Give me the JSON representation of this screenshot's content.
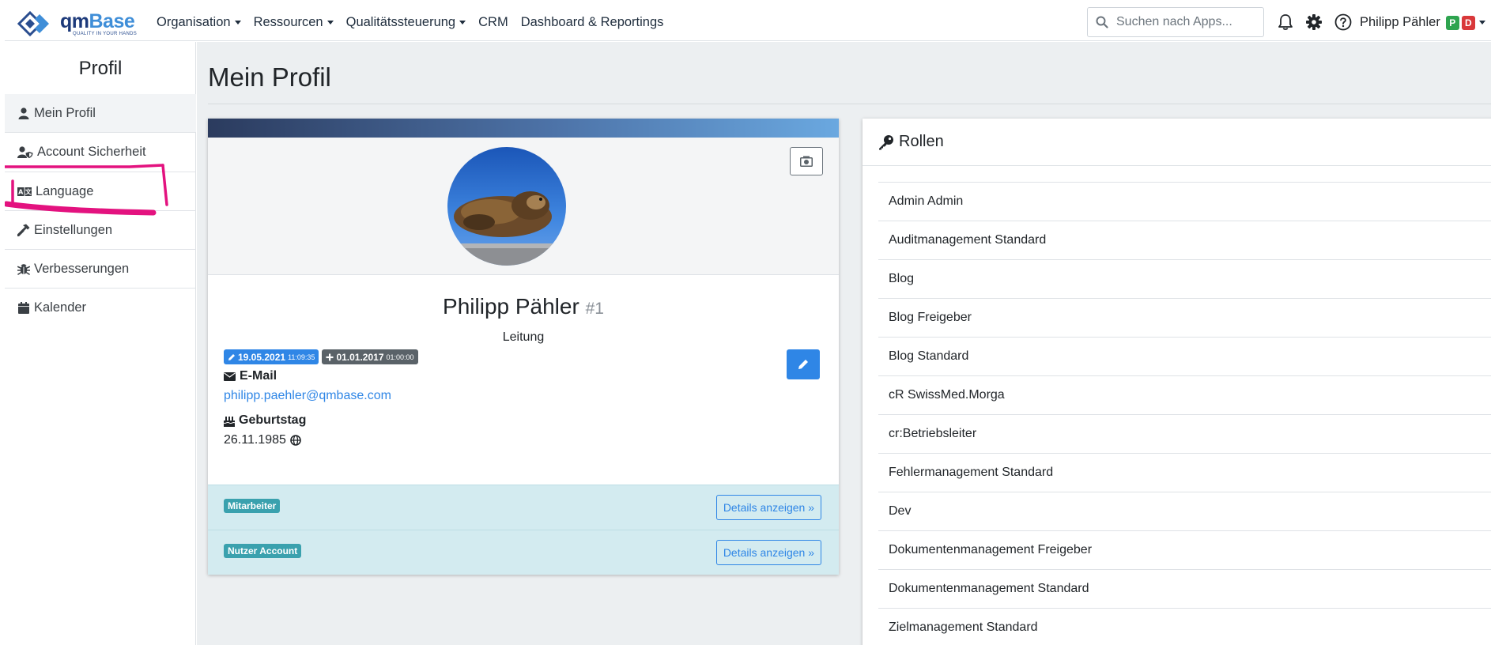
{
  "brand": {
    "name_part1": "qm",
    "name_part2": "Base",
    "tagline": "QUALITY IN YOUR HANDS"
  },
  "nav": {
    "menu": [
      {
        "label": "Organisation",
        "dropdown": true
      },
      {
        "label": "Ressourcen",
        "dropdown": true
      },
      {
        "label": "Qualitätssteuerung",
        "dropdown": true
      },
      {
        "label": "CRM",
        "dropdown": false
      },
      {
        "label": "Dashboard & Reportings",
        "dropdown": false
      }
    ],
    "search_placeholder": "Suchen nach Apps...",
    "icons": [
      "bell-icon",
      "gear-icon",
      "help-icon",
      "search-icon"
    ],
    "user": {
      "name": "Philipp Pähler",
      "badge1": "P",
      "badge2": "D",
      "badge1_color": "#2ea44f",
      "badge2_color": "#d9383a"
    }
  },
  "sidebar": {
    "title": "Profil",
    "items": [
      {
        "label": "Mein Profil",
        "icon": "user-icon"
      },
      {
        "label": "Account Sicherheit",
        "icon": "user-shield-icon"
      },
      {
        "label": "Language",
        "icon": "language-icon"
      },
      {
        "label": "Einstellungen",
        "icon": "hammer-icon"
      },
      {
        "label": "Verbesserungen",
        "icon": "bug-icon"
      },
      {
        "label": "Kalender",
        "icon": "calendar-icon"
      }
    ],
    "annotation_color": "#e3127f"
  },
  "main": {
    "title": "Mein Profil",
    "profile": {
      "name": "Philipp Pähler",
      "id": "#1",
      "role": "Leitung",
      "updated_date": "19.05.2021",
      "updated_time": "11:09:35",
      "created_date": "01.01.2017",
      "created_time": "01:00:00",
      "email_label": "E-Mail",
      "email": "philipp.paehler@qmbase.com",
      "birthday_label": "Geburtstag",
      "birthday": "26.11.1985",
      "sections": [
        {
          "badge": "Mitarbeiter",
          "button": "Details anzeigen »"
        },
        {
          "badge": "Nutzer Account",
          "button": "Details anzeigen »"
        }
      ]
    },
    "roles": {
      "title": "Rollen",
      "items": [
        "Admin Admin",
        "Auditmanagement Standard",
        "Blog",
        "Blog Freigeber",
        "Blog Standard",
        "cR SwissMed.Morga",
        "cr:Betriebsleiter",
        "Fehlermanagement Standard",
        "Dev",
        "Dokumentenmanagement Freigeber",
        "Dokumentenmanagement Standard",
        "Zielmanagement Standard"
      ]
    }
  },
  "colors": {
    "primary": "#2f86e6",
    "info": "#3aa1ae",
    "secondary_badge": "#5a6268"
  }
}
